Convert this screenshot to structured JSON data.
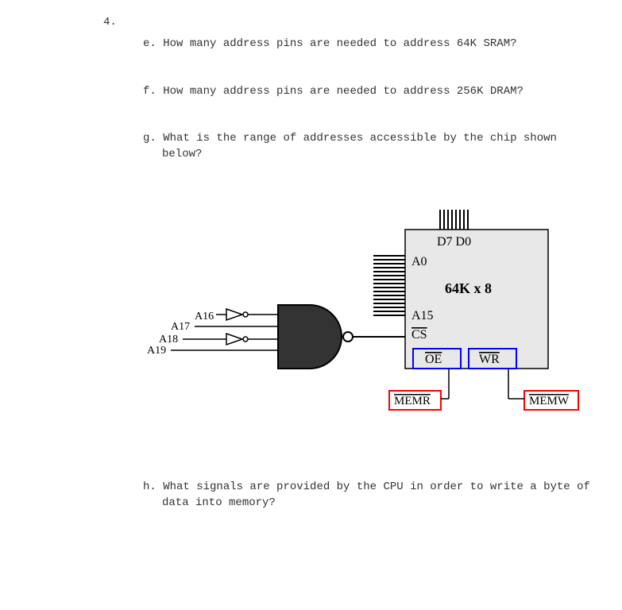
{
  "questionNumber": "4.",
  "subQuestions": {
    "e": {
      "letter": "e.",
      "text": "How many address pins are needed to address 64K SRAM?"
    },
    "f": {
      "letter": "f.",
      "text": "How many address pins are needed to address 256K DRAM?"
    },
    "g": {
      "letter": "g.",
      "text": "What is the range of addresses accessible by the chip shown below?"
    },
    "h": {
      "letter": "h.",
      "text": "What signals are provided by the CPU in order to write a byte of data into memory?"
    }
  },
  "diagram": {
    "inputs": {
      "a16": "A16",
      "a17": "A17",
      "a18": "A18",
      "a19": "A19"
    },
    "chip": {
      "dataPins": "D7  D0",
      "addrLow": "A0",
      "addrHigh": "A15",
      "size": "64K x 8",
      "cs": "CS",
      "oe": "OE",
      "wr": "WR"
    },
    "signals": {
      "memr": "MEMR",
      "memw": "MEMW"
    }
  }
}
